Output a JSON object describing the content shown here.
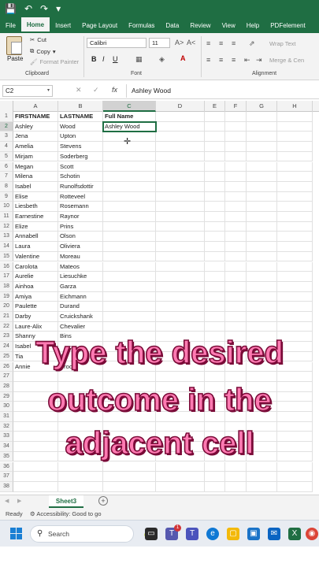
{
  "menu": {
    "tabs": [
      "File",
      "Home",
      "Insert",
      "Page Layout",
      "Formulas",
      "Data",
      "Review",
      "View",
      "Help",
      "PDFelement"
    ],
    "active": "Home"
  },
  "ribbon": {
    "paste": "Paste",
    "cut": "Cut",
    "copy": "Copy",
    "format_painter": "Format Painter",
    "clipboard_label": "Clipboard",
    "font_name": "Calibri",
    "font_size": "11",
    "bold": "B",
    "italic": "I",
    "underline": "U",
    "font_label": "Font",
    "wrap_text": "Wrap Text",
    "merge": "Merge & Cen",
    "alignment_label": "Alignment"
  },
  "formula_bar": {
    "name_box": "C2",
    "fx": "fx",
    "value": "Ashley Wood"
  },
  "grid": {
    "columns": [
      "A",
      "B",
      "C",
      "D",
      "E",
      "F",
      "G",
      "H"
    ],
    "selected_column": "C",
    "header_row": [
      "FIRSTNAME",
      "LASTNAME",
      "Full Name"
    ],
    "rows": [
      [
        "Ashley",
        "Wood",
        "Ashley Wood"
      ],
      [
        "Jena",
        "Upton",
        ""
      ],
      [
        "Amelia",
        "Stevens",
        ""
      ],
      [
        "Mirjam",
        "Soderberg",
        ""
      ],
      [
        "Megan",
        "Scott",
        ""
      ],
      [
        "Milena",
        "Schotin",
        ""
      ],
      [
        "Isabel",
        "Runolfsdottir",
        ""
      ],
      [
        "Elise",
        "Rotteveel",
        ""
      ],
      [
        "Liesbeth",
        "Rosemann",
        ""
      ],
      [
        "Earnestine",
        "Raynor",
        ""
      ],
      [
        "Elize",
        "Prins",
        ""
      ],
      [
        "Annabell",
        "Olson",
        ""
      ],
      [
        "Laura",
        "Oliviera",
        ""
      ],
      [
        "Valentine",
        "Moreau",
        ""
      ],
      [
        "Carolota",
        "Mateos",
        ""
      ],
      [
        "Aurelie",
        "Liesuchke",
        ""
      ],
      [
        "Ainhoa",
        "Garza",
        ""
      ],
      [
        "Amiya",
        "Eichmann",
        ""
      ],
      [
        "Paulette",
        "Durand",
        ""
      ],
      [
        "Darby",
        "Cruickshank",
        ""
      ],
      [
        "Laure-Alix",
        "Chevalier",
        ""
      ],
      [
        "Shanny",
        "Bins",
        ""
      ],
      [
        "Isabel",
        "",
        ""
      ],
      [
        "Tia",
        "A",
        ""
      ],
      [
        "Annie",
        "Brook",
        ""
      ]
    ],
    "total_rows": 38,
    "active_row": 2
  },
  "caption": {
    "line1": "Type the desired",
    "line2": "outcome in the",
    "line3": "adjacent cell"
  },
  "sheets": {
    "active": "Sheet3",
    "add": "+"
  },
  "status": {
    "ready": "Ready",
    "accessibility": "Accessibility: Good to go"
  },
  "taskbar": {
    "search": "Search",
    "badge": "1"
  },
  "colors": {
    "excel_green": "#1f6e43",
    "caption_fill": "#ff7ab2",
    "caption_outline": "#7a0b38"
  }
}
